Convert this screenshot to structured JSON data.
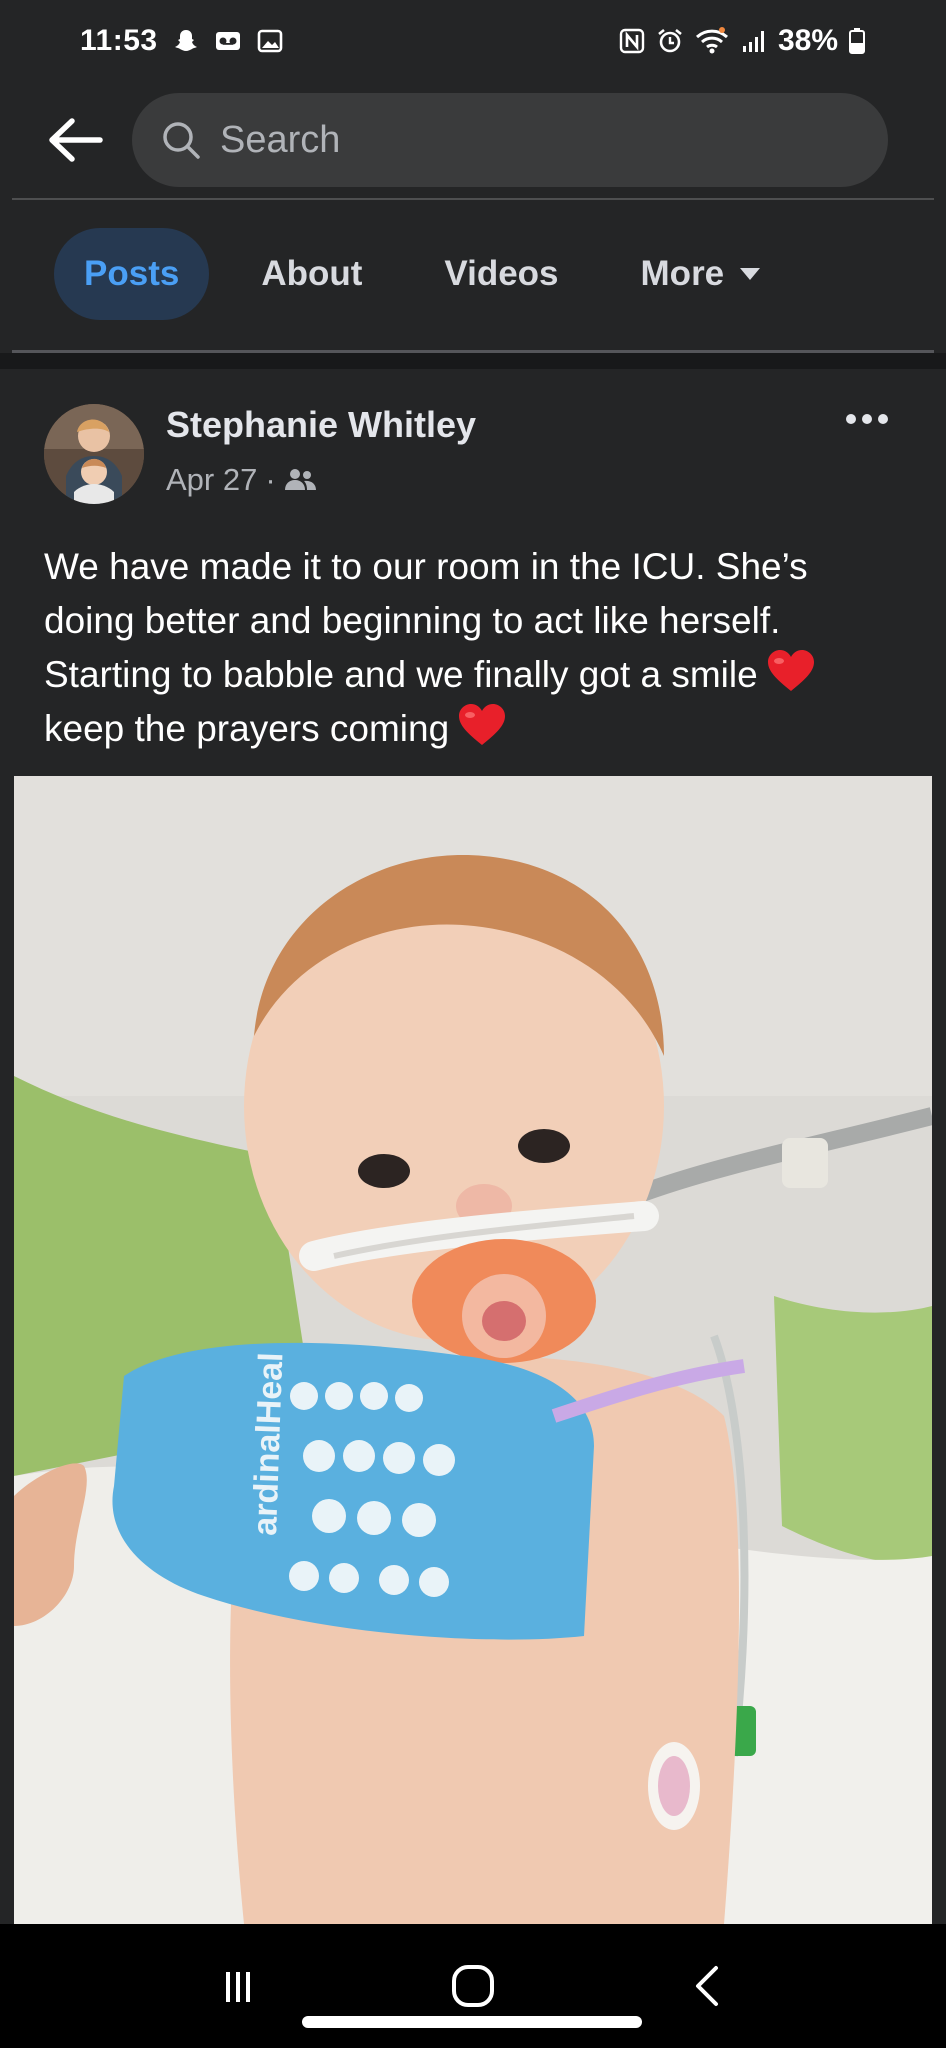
{
  "status_bar": {
    "time": "11:53",
    "battery": "38%",
    "icons": [
      "snapchat-icon",
      "voicemail-icon",
      "gallery-icon",
      "nfc-icon",
      "alarm-icon",
      "wifi-icon",
      "signal-icon",
      "battery-icon"
    ]
  },
  "header": {
    "search_placeholder": "Search"
  },
  "tabs": [
    {
      "label": "Posts",
      "active": true
    },
    {
      "label": "About",
      "active": false
    },
    {
      "label": "Videos",
      "active": false
    },
    {
      "label": "More",
      "active": false
    }
  ],
  "post": {
    "author": "Stephanie Whitley",
    "date": "Apr 27",
    "date_separator": "·",
    "audience_icon": "friends-icon",
    "text_lines": [
      "We have made it to our room in the ICU. She’s",
      "doing better and beginning to act like herself.",
      "Starting to babble and we finally got a smile",
      "keep the prayers coming"
    ],
    "photo_sock_text": "ardinalHeal"
  },
  "colors": {
    "background": "#242526",
    "tab_active_bg": "#263951",
    "tab_active_text": "#4a9ff5",
    "heart": "#e8202a"
  }
}
